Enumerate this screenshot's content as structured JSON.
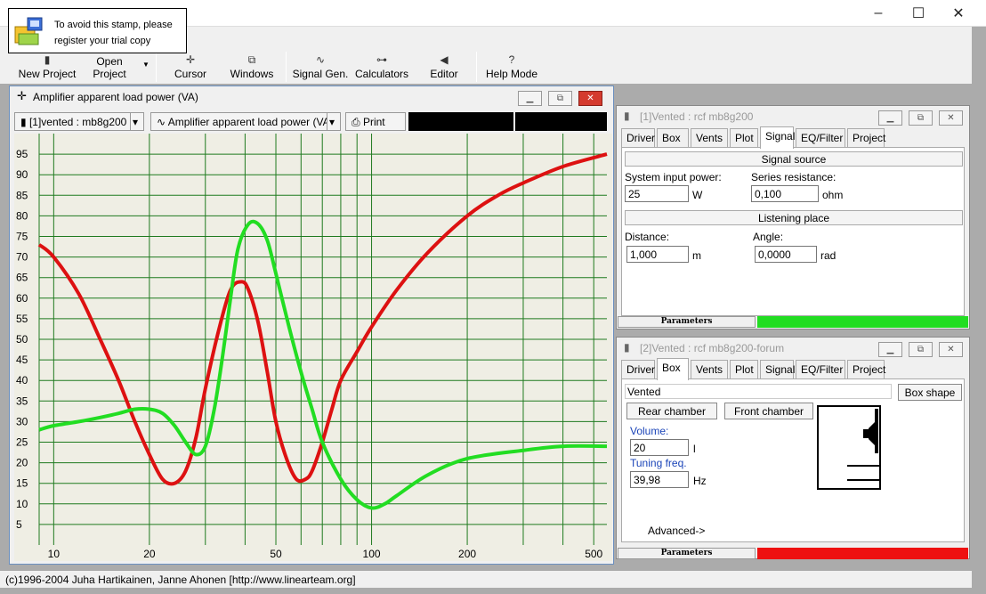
{
  "stamp": {
    "line1": "To avoid this stamp, please",
    "line2": "register your trial copy"
  },
  "window_controls": {
    "minimize": "–",
    "maximize": "☐",
    "close": "✕"
  },
  "toolbar": {
    "new_project": "New Project",
    "open_project": "Open Project",
    "cursor": "Cursor",
    "windows": "Windows",
    "signal_gen": "Signal Gen.",
    "calculators": "Calculators",
    "editor": "Editor",
    "help_mode": "Help Mode"
  },
  "chart_window": {
    "title": "Amplifier apparent load power (VA)",
    "project_select": "[1]vented : mb8g200",
    "graph_select": "Amplifier apparent load power (VA)",
    "print": "Print"
  },
  "chart_data": {
    "type": "line",
    "title": "",
    "xlabel": "",
    "ylabel": "",
    "x_scale": "log",
    "xlim": [
      9,
      550
    ],
    "ylim": [
      0,
      100
    ],
    "grid": true,
    "x_ticks": [
      10,
      20,
      50,
      100,
      200,
      500
    ],
    "y_ticks": [
      5,
      10,
      15,
      20,
      25,
      30,
      35,
      40,
      45,
      50,
      55,
      60,
      65,
      70,
      75,
      80,
      85,
      90,
      95
    ],
    "series": [
      {
        "color": "#dd1111",
        "x": [
          9,
          10,
          12,
          14,
          16,
          18,
          20,
          22,
          24,
          26,
          28,
          30,
          33,
          36,
          39,
          41,
          44,
          47,
          50,
          54,
          58,
          62,
          65,
          70,
          75,
          80,
          90,
          100,
          120,
          150,
          200,
          250,
          300,
          400,
          550
        ],
        "y": [
          73,
          70,
          61,
          50,
          40,
          30,
          22,
          16,
          15,
          18,
          26,
          38,
          52,
          62,
          64,
          62,
          54,
          42,
          30,
          21,
          16,
          16,
          18,
          25,
          33,
          40,
          47,
          53,
          62,
          71,
          80,
          85,
          88,
          92,
          95
        ]
      },
      {
        "color": "#22dd22",
        "x": [
          9,
          10,
          12,
          14,
          16,
          18,
          20,
          22,
          24,
          26,
          28,
          30,
          32,
          34,
          36,
          38,
          41,
          44,
          47,
          50,
          55,
          60,
          65,
          70,
          80,
          90,
          100,
          110,
          120,
          150,
          200,
          300,
          400,
          550
        ],
        "y": [
          28,
          29,
          30,
          31,
          32,
          33,
          33,
          32,
          29,
          25,
          22,
          24,
          33,
          46,
          60,
          72,
          78,
          78,
          74,
          66,
          53,
          42,
          33,
          25,
          16,
          11,
          9,
          10,
          12,
          17,
          21,
          23,
          24,
          24
        ]
      }
    ]
  },
  "signal_window": {
    "title": "[1]Vented : rcf mb8g200",
    "tabs": [
      "Driver",
      "Box",
      "Vents",
      "Plot",
      "Signal",
      "EQ/Filter",
      "Project"
    ],
    "active_tab": "Signal",
    "signal_source": "Signal source",
    "system_input_power_label": "System input power:",
    "system_input_power": "25",
    "power_unit": "W",
    "series_resistance_label": "Series resistance:",
    "series_resistance": "0,100",
    "resistance_unit": "ohm",
    "listening_place": "Listening place",
    "distance_label": "Distance:",
    "distance": "1,000",
    "distance_unit": "m",
    "angle_label": "Angle:",
    "angle": "0,0000",
    "angle_unit": "rad",
    "parameters": "Parameters",
    "param_color": "#22dd22"
  },
  "box_window": {
    "title": "[2]Vented : rcf mb8g200-forum",
    "tabs": [
      "Driver",
      "Box",
      "Vents",
      "Plot",
      "Signal",
      "EQ/Filter",
      "Project"
    ],
    "active_tab": "Box",
    "box_type": "Vented",
    "box_shape": "Box shape",
    "rear_chamber": "Rear chamber",
    "front_chamber": "Front chamber",
    "volume_label": "Volume:",
    "volume": "20",
    "volume_unit": "l",
    "tuning_label": "Tuning freq.",
    "tuning": "39,98",
    "tuning_unit": "Hz",
    "advanced": "Advanced->",
    "parameters": "Parameters",
    "param_color": "#ee1111"
  },
  "status": "(c)1996-2004 Juha Hartikainen, Janne Ahonen [http://www.linearteam.org]"
}
